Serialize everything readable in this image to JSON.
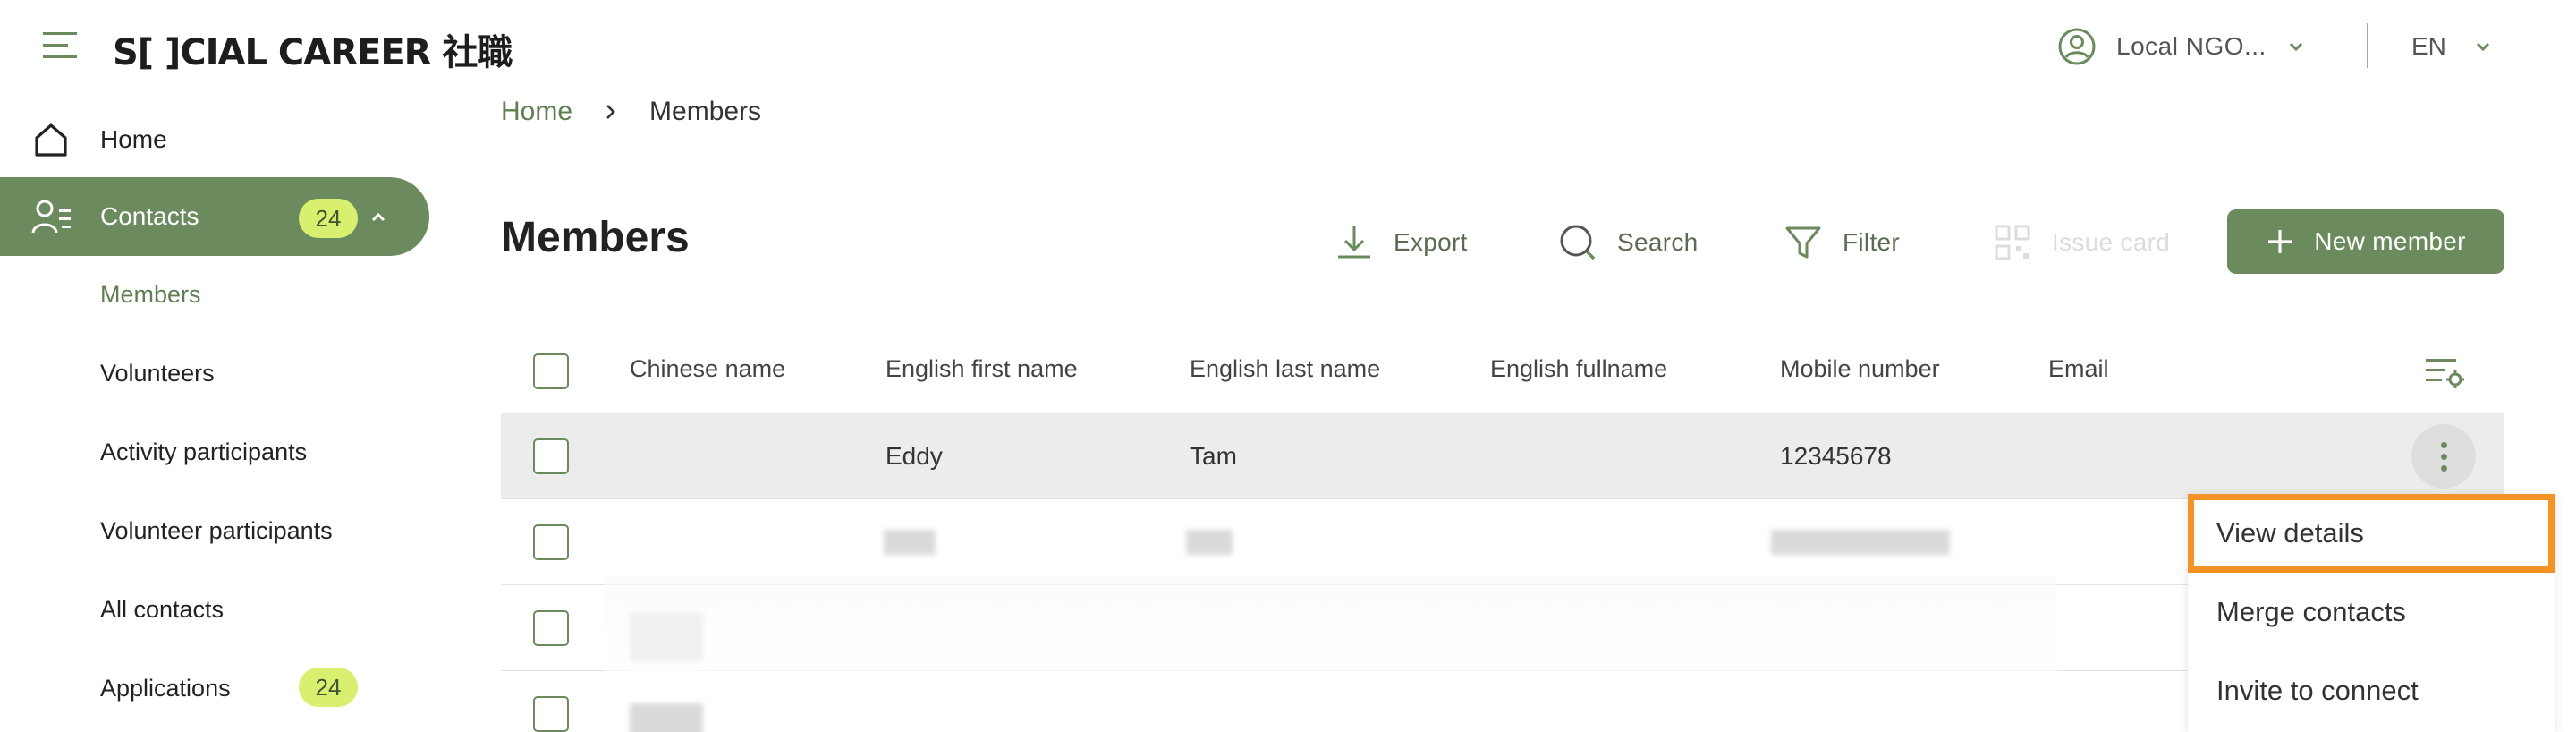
{
  "header": {
    "logo_text": "S[ ]CIAL CAREER 社職",
    "user_label": "Local NGO...",
    "language": "EN"
  },
  "sidebar": {
    "home_label": "Home",
    "contacts_label": "Contacts",
    "contacts_count": "24",
    "sub_items": [
      {
        "label": "Members",
        "active": true
      },
      {
        "label": "Volunteers"
      },
      {
        "label": "Activity participants"
      },
      {
        "label": "Volunteer participants"
      },
      {
        "label": "All contacts"
      },
      {
        "label": "Applications"
      }
    ],
    "applications_count": "24"
  },
  "breadcrumb": {
    "home": "Home",
    "current": "Members"
  },
  "main": {
    "title": "Members",
    "toolbar": {
      "export_label": "Export",
      "search_label": "Search",
      "filter_label": "Filter",
      "issue_card_label": "Issue card",
      "new_member_label": "New member"
    }
  },
  "table": {
    "columns": [
      "Chinese name",
      "English first name",
      "English last name",
      "English fullname",
      "Mobile number",
      "Email"
    ],
    "rows": [
      {
        "chinese_name": "",
        "first_name": "Eddy",
        "last_name": "Tam",
        "fullname": "",
        "mobile": "12345678",
        "email": ""
      }
    ]
  },
  "context_menu": {
    "items": [
      "View details",
      "Merge contacts",
      "Invite to connect"
    ]
  },
  "colors": {
    "accent": "#6b8a5d",
    "badge": "#d9ef6f",
    "highlight_outline": "#f39225"
  }
}
